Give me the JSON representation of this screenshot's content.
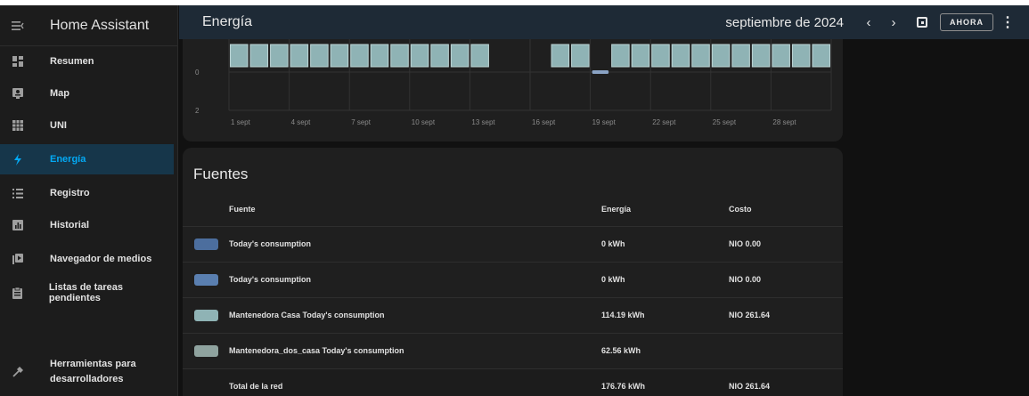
{
  "app": {
    "title": "Home Assistant"
  },
  "header": {
    "title": "Energía",
    "period": "septiembre de 2024",
    "prev_label": "‹",
    "next_label": "›",
    "now_label": "AHORA"
  },
  "sidebar": {
    "items": [
      {
        "label": "Resumen",
        "icon": "dashboard-icon"
      },
      {
        "label": "Map",
        "icon": "map-icon"
      },
      {
        "label": "UNI",
        "icon": "calendar-grid-icon"
      },
      {
        "label": "Energía",
        "icon": "lightning-icon",
        "active": true
      },
      {
        "label": "Registro",
        "icon": "list-icon"
      },
      {
        "label": "Historial",
        "icon": "chart-box-icon"
      },
      {
        "label": "Navegador de medios",
        "icon": "play-box-icon"
      },
      {
        "label": "Listas de tareas pendientes",
        "icon": "clipboard-list-icon"
      },
      {
        "label": "Herramientas para desarrolladores",
        "icon": "hammer-icon"
      }
    ]
  },
  "chart_data": {
    "type": "bar",
    "y_ticks": [
      "0",
      "2"
    ],
    "x_tick_labels": [
      "1 sept",
      "4 sept",
      "7 sept",
      "10 sept",
      "13 sept",
      "16 sept",
      "19 sept",
      "22 sept",
      "25 sept",
      "28 sept"
    ],
    "days": [
      1,
      2,
      3,
      4,
      5,
      6,
      7,
      8,
      9,
      10,
      11,
      12,
      13,
      14,
      15,
      16,
      17,
      18,
      19,
      20,
      21,
      22,
      23,
      24,
      25,
      26,
      27,
      28,
      29,
      30
    ],
    "present": [
      true,
      true,
      true,
      true,
      true,
      true,
      true,
      true,
      true,
      true,
      true,
      true,
      true,
      false,
      false,
      false,
      true,
      true,
      false,
      true,
      true,
      true,
      true,
      true,
      true,
      true,
      true,
      true,
      true,
      true
    ],
    "negative_day": 19,
    "colors": {
      "bar": "#8fb3b5",
      "bar_edge": "#bcd4d5",
      "negative": "#8aa3c4",
      "grid": "#333333"
    }
  },
  "sources": {
    "title": "Fuentes",
    "columns": {
      "source": "Fuente",
      "energy": "Energía",
      "cost": "Costo"
    },
    "rows": [
      {
        "name": "Today's consumption",
        "energy": "0 kWh",
        "cost": "NIO 0.00",
        "color": "#4c6e9e"
      },
      {
        "name": "Today's consumption",
        "energy": "0 kWh",
        "cost": "NIO 0.00",
        "color": "#5a7fb0"
      },
      {
        "name": "Mantenedora Casa Today's consumption",
        "energy": "114.19 kWh",
        "cost": "NIO 261.64",
        "color": "#8fb3b5"
      },
      {
        "name": "Mantenedora_dos_casa Today's consumption",
        "energy": "62.56 kWh",
        "cost": "",
        "color": "#8fa39f"
      }
    ],
    "total": {
      "name": "Total de la red",
      "energy": "176.76 kWh",
      "cost": "NIO 261.64"
    }
  }
}
